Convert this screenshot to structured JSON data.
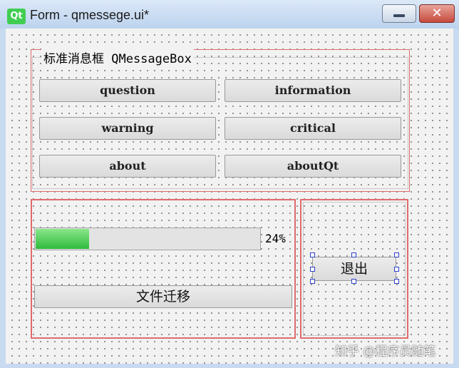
{
  "window": {
    "logo": "Qt",
    "title": "Form - qmessege.ui*",
    "minimize_icon": "minimize-icon",
    "close_icon": "close-icon"
  },
  "groupbox": {
    "title": "标准消息框 QMessageBox",
    "buttons": [
      {
        "label": "question"
      },
      {
        "label": "information"
      },
      {
        "label": "warning"
      },
      {
        "label": "critical"
      },
      {
        "label": "about"
      },
      {
        "label": "aboutQt"
      }
    ]
  },
  "progress": {
    "value": 24,
    "text": "24%",
    "fill_color": "#2fbb3c"
  },
  "migrate_button": {
    "label": "文件迁移"
  },
  "quit_button": {
    "label": "退出"
  },
  "watermark": "知乎 @程序员随笔",
  "colors": {
    "layout_border": "#e06b6b",
    "selection_handle": "#2b3fc7",
    "close_button": "#c64a3c",
    "qt_green": "#41cd52"
  }
}
